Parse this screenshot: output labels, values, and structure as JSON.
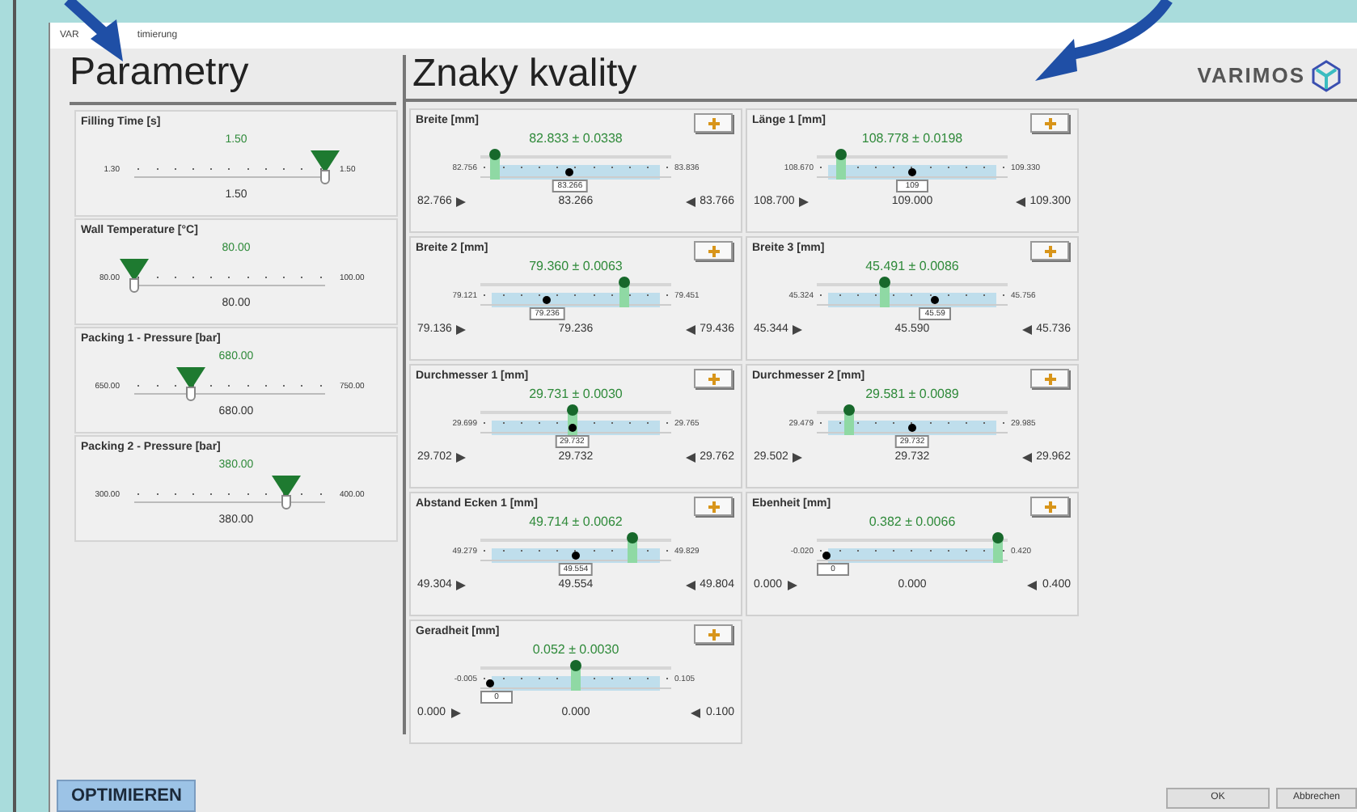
{
  "window": {
    "title_parts": [
      "VAR",
      "timierung"
    ]
  },
  "logo": {
    "text": "VARIMOS"
  },
  "parameters": {
    "title": "Parametry",
    "items": [
      {
        "label": "Filling Time [s]",
        "value": "1.50",
        "min": "1.30",
        "max": "1.50",
        "level": 1,
        "reading": "1.50"
      },
      {
        "label": "Wall Temperature [°C]",
        "value": "80.00",
        "min": "80.00",
        "max": "100.00",
        "level": 0,
        "reading": "80.00"
      },
      {
        "label": "Packing 1 - Pressure [bar]",
        "value": "680.00",
        "min": "650.00",
        "max": "750.00",
        "level": 0.3,
        "reading": "680.00"
      },
      {
        "label": "Packing 2 - Pressure [bar]",
        "value": "380.00",
        "min": "300.00",
        "max": "400.00",
        "level": 0.8,
        "reading": "380.00"
      }
    ]
  },
  "quality": {
    "title": "Znaky kvality",
    "items": [
      {
        "label": "Breite [mm]",
        "estimate": "82.833 ± 0.0338",
        "scale_min": "82.756",
        "scale_max": "83.836",
        "level": 0.08,
        "target": {
          "value": "83.266",
          "level": 0.47
        },
        "lower": "82.766",
        "nominal": "83.266",
        "upper": "83.766"
      },
      {
        "label": "Länge 1 [mm]",
        "estimate": "108.778 ± 0.0198",
        "scale_min": "108.670",
        "scale_max": "109.330",
        "level": 0.13,
        "target": {
          "value": "109",
          "level": 0.5
        },
        "lower": "108.700",
        "nominal": "109.000",
        "upper": "109.300"
      },
      {
        "label": "Breite 2 [mm]",
        "estimate": "79.360 ± 0.0063",
        "scale_min": "79.121",
        "scale_max": "79.451",
        "level": 0.75,
        "target": {
          "value": "79.236",
          "level": 0.35
        },
        "lower": "79.136",
        "nominal": "79.236",
        "upper": "79.436"
      },
      {
        "label": "Breite 3 [mm]",
        "estimate": "45.491 ± 0.0086",
        "scale_min": "45.324",
        "scale_max": "45.756",
        "level": 0.36,
        "target": {
          "value": "45.59",
          "level": 0.62
        },
        "lower": "45.344",
        "nominal": "45.590",
        "upper": "45.736"
      },
      {
        "label": "Durchmesser 1 [mm]",
        "estimate": "29.731 ± 0.0030",
        "scale_min": "29.699",
        "scale_max": "29.765",
        "level": 0.48,
        "target": {
          "value": "29.732",
          "level": 0.48
        },
        "lower": "29.702",
        "nominal": "29.732",
        "upper": "29.762"
      },
      {
        "label": "Durchmesser 2 [mm]",
        "estimate": "29.581 ± 0.0089",
        "scale_min": "29.479",
        "scale_max": "29.985",
        "level": 0.17,
        "target": {
          "value": "29.732",
          "level": 0.5
        },
        "lower": "29.502",
        "nominal": "29.732",
        "upper": "29.962"
      },
      {
        "label": "Abstand Ecken 1 [mm]",
        "estimate": "49.714 ± 0.0062",
        "scale_min": "49.279",
        "scale_max": "49.829",
        "level": 0.8,
        "target": {
          "value": "49.554",
          "level": 0.5
        },
        "lower": "49.304",
        "nominal": "49.554",
        "upper": "49.804"
      },
      {
        "label": "Ebenheit [mm]",
        "estimate": "0.382 ± 0.0066",
        "scale_min": "-0.020",
        "scale_max": "0.420",
        "level": 0.95,
        "target": {
          "value": "0",
          "level": 0.05
        },
        "lower": "0.000",
        "nominal": "0.000",
        "upper": "0.400"
      },
      {
        "label": "Geradheit [mm]",
        "estimate": "0.052 ± 0.0030",
        "scale_min": "-0.005",
        "scale_max": "0.105",
        "level": 0.5,
        "target": {
          "value": "0",
          "level": 0.05
        },
        "lower": "0.000",
        "nominal": "0.000",
        "upper": "0.100"
      }
    ]
  },
  "buttons": {
    "optimize": "OPTIMIEREN",
    "ok": "OK",
    "cancel": "Abbrechen"
  }
}
